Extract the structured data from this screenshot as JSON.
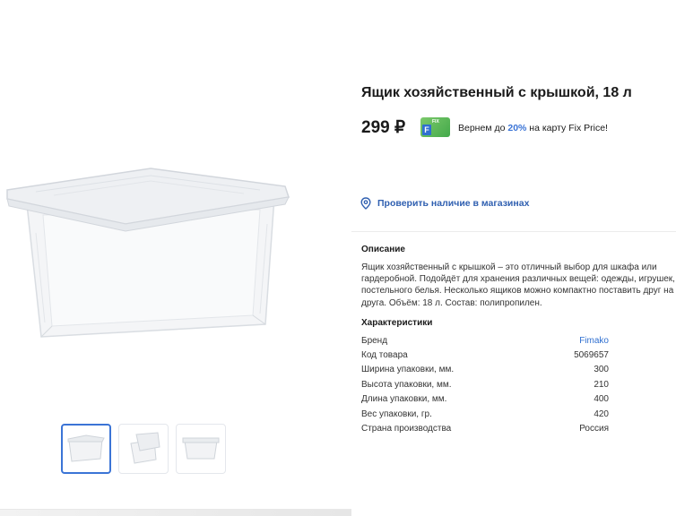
{
  "product": {
    "title": "Ящик хозяйственный с крышкой, 18 л",
    "price": "299 ₽",
    "cashback_prefix": "Вернем до",
    "cashback_percent": "20%",
    "cashback_suffix": "на карту Fix Price!",
    "card_badge_text": "FIX"
  },
  "stores_link": "Проверить наличие в магазинах",
  "description": {
    "heading": "Описание",
    "text": "Ящик хозяйственный с крышкой – это отличный выбор для шкафа или гардеробной. Подойдёт для хранения различных вещей: одежды, игрушек, постельного белья. Несколько ящиков можно компактно поставить друг на друга. Объём: 18 л. Состав: полипропилен."
  },
  "specs": {
    "heading": "Характеристики",
    "rows": [
      {
        "label": "Бренд",
        "value": "Fimako"
      },
      {
        "label": "Код товара",
        "value": "5069657"
      },
      {
        "label": "Ширина упаковки, мм.",
        "value": "300"
      },
      {
        "label": "Высота упаковки, мм.",
        "value": "210"
      },
      {
        "label": "Длина упаковки, мм.",
        "value": "400"
      },
      {
        "label": "Вес упаковки, гр.",
        "value": "420"
      },
      {
        "label": "Страна производства",
        "value": "Россия"
      }
    ]
  },
  "gallery": {
    "selected_index": 0,
    "thumbnails": [
      "box-front",
      "box-open",
      "box-side"
    ]
  },
  "colors": {
    "accent": "#3b74d6",
    "link": "#2f5fb0",
    "card_green": "#43a94a"
  },
  "icons": {
    "stores": "location-pin-icon"
  }
}
